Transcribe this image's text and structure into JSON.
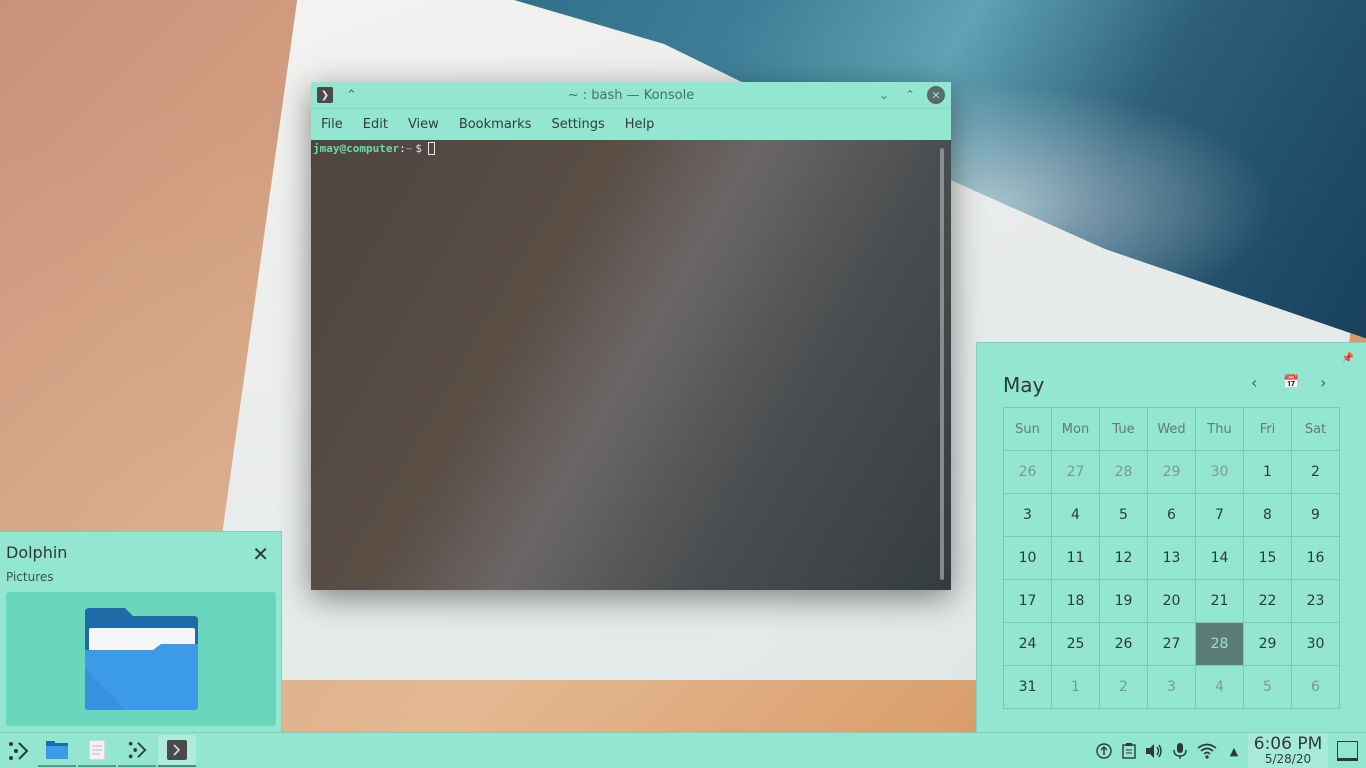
{
  "konsole": {
    "title": "~ : bash — Konsole",
    "menu": [
      "File",
      "Edit",
      "View",
      "Bookmarks",
      "Settings",
      "Help"
    ],
    "prompt_user": "jmay@computer",
    "prompt_colon": ":",
    "prompt_path": "~",
    "prompt_symbol": "$"
  },
  "calendar": {
    "month": "May",
    "weekdays": [
      "Sun",
      "Mon",
      "Tue",
      "Wed",
      "Thu",
      "Fri",
      "Sat"
    ],
    "days": [
      "26",
      "27",
      "28",
      "29",
      "30",
      "1",
      "2",
      "3",
      "4",
      "5",
      "6",
      "7",
      "8",
      "9",
      "10",
      "11",
      "12",
      "13",
      "14",
      "15",
      "16",
      "17",
      "18",
      "19",
      "20",
      "21",
      "22",
      "23",
      "24",
      "25",
      "26",
      "27",
      "28",
      "29",
      "30",
      "31",
      "1",
      "2",
      "3",
      "4",
      "5",
      "6"
    ],
    "today": "28"
  },
  "notification": {
    "app": "Dolphin",
    "body": "Pictures"
  },
  "taskbar": {
    "time": "6:06 PM",
    "date": "5/28/20"
  },
  "colors": {
    "accent": "#93e6cf",
    "today_bg": "#5b7d75"
  }
}
